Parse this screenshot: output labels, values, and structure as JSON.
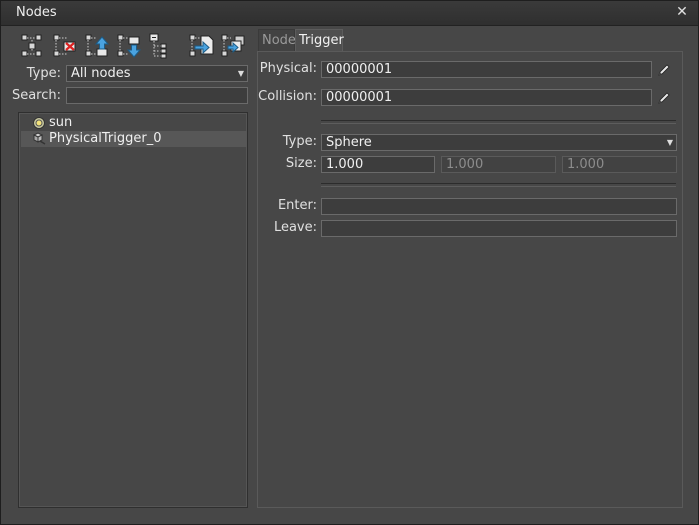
{
  "window": {
    "title": "Nodes",
    "close_glyph": "✕"
  },
  "toolbar": {
    "buttons": [
      {
        "icon": "group-nodes-icon"
      },
      {
        "icon": "delete-node-icon"
      },
      {
        "icon": "move-node-up-icon"
      },
      {
        "icon": "move-node-down-icon"
      },
      {
        "icon": "expand-hierarchy-icon"
      },
      {
        "icon": "import-node-icon"
      },
      {
        "icon": "clone-node-icon"
      }
    ]
  },
  "filter": {
    "type_label": "Type:",
    "type_value": "All nodes",
    "search_label": "Search:",
    "search_value": ""
  },
  "tree": {
    "items": [
      {
        "label": "sun",
        "icon": "world-light-icon",
        "selected": false
      },
      {
        "label": "PhysicalTrigger_0",
        "icon": "physical-trigger-icon",
        "selected": true
      }
    ]
  },
  "tabs": [
    {
      "label": "Node",
      "active": false
    },
    {
      "label": "Trigger",
      "active": true
    }
  ],
  "trigger": {
    "physical_label": "Physical:",
    "physical_value": "00000001",
    "collision_label": "Collision:",
    "collision_value": "00000001",
    "type_label": "Type:",
    "type_value": "Sphere",
    "size_label": "Size:",
    "size_x": "1.000",
    "size_y": "1.000",
    "size_z": "1.000",
    "enter_label": "Enter:",
    "enter_value": "",
    "leave_label": "Leave:",
    "leave_value": ""
  },
  "colors": {
    "background": "#474747",
    "field": "#3d3d3d",
    "accent_blue": "#4aa3e0"
  }
}
